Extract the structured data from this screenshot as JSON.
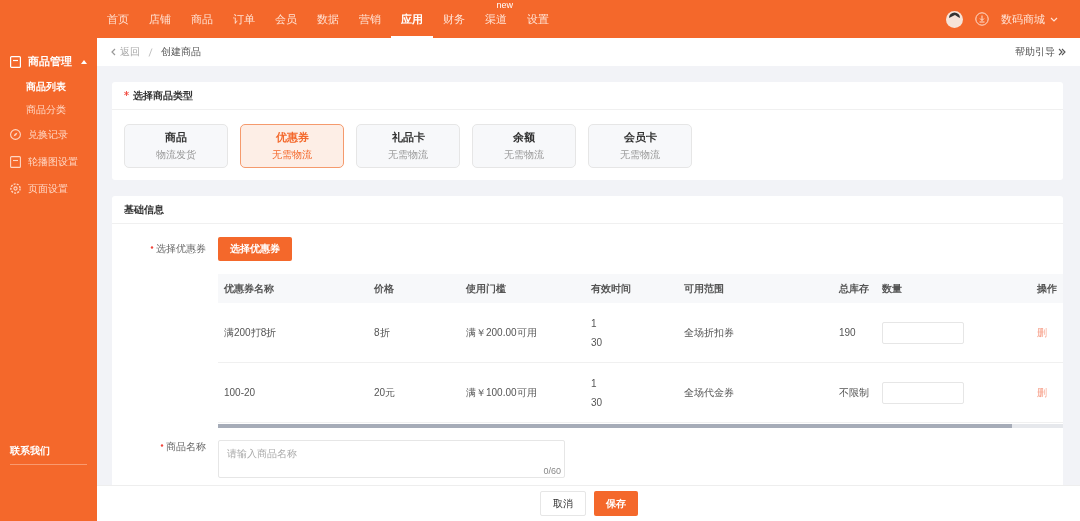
{
  "nav": {
    "items": [
      {
        "label": "首页",
        "selected": false
      },
      {
        "label": "店铺",
        "selected": false
      },
      {
        "label": "商品",
        "selected": false
      },
      {
        "label": "订单",
        "selected": false
      },
      {
        "label": "会员",
        "selected": false
      },
      {
        "label": "数据",
        "selected": false
      },
      {
        "label": "营销",
        "selected": false
      },
      {
        "label": "应用",
        "selected": true
      },
      {
        "label": "财务",
        "selected": false
      },
      {
        "label": "渠道",
        "selected": false,
        "badge": "new"
      },
      {
        "label": "设置",
        "selected": false
      }
    ],
    "store": "数码商城"
  },
  "sidebar": {
    "items": [
      {
        "label": "商品管理",
        "expanded": true,
        "children": [
          {
            "label": "商品列表",
            "selected": true
          },
          {
            "label": "商品分类",
            "selected": false
          }
        ]
      },
      {
        "label": "兑换记录"
      },
      {
        "label": "轮播图设置"
      },
      {
        "label": "页面设置"
      }
    ],
    "footer": "联系我们"
  },
  "breadcrumb": {
    "back": "返回",
    "current": "创建商品",
    "help": "帮助引导"
  },
  "type_section": {
    "title": "选择商品类型",
    "required": true,
    "types": [
      {
        "name": "商品",
        "sub": "物流发货",
        "selected": false
      },
      {
        "name": "优惠券",
        "sub": "无需物流",
        "selected": true
      },
      {
        "name": "礼品卡",
        "sub": "无需物流",
        "selected": false
      },
      {
        "name": "余额",
        "sub": "无需物流",
        "selected": false
      },
      {
        "name": "会员卡",
        "sub": "无需物流",
        "selected": false
      }
    ]
  },
  "basic": {
    "title": "基础信息",
    "coupon_field": {
      "label": "选择优惠券",
      "required": true,
      "button": "选择优惠券"
    },
    "table": {
      "columns": [
        "优惠券名称",
        "价格",
        "使用门槛",
        "有效时间",
        "可用范围",
        "总库存",
        "数量",
        "操作"
      ],
      "rows": [
        {
          "name": "满200打8折",
          "price": "8折",
          "threshold": "满￥200.00可用",
          "time": [
            "1",
            "30"
          ],
          "scope": "全场折扣券",
          "stock": "190",
          "action": "删"
        },
        {
          "name": "100-20",
          "price": "20元",
          "threshold": "满￥100.00可用",
          "time": [
            "1",
            "30"
          ],
          "scope": "全场代金券",
          "stock": "不限制",
          "action": "删"
        }
      ]
    },
    "name_field": {
      "label": "商品名称",
      "required": true,
      "placeholder": "请输入商品名称",
      "counter": "0/60"
    }
  },
  "footer": {
    "cancel": "取消",
    "save": "保存"
  }
}
